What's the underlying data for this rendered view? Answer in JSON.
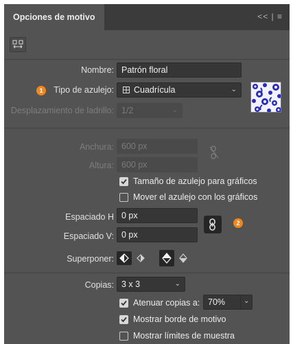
{
  "window": {
    "title": "Opciones de motivo",
    "controls": "<< | ≡"
  },
  "fields": {
    "nombre_label": "Nombre:",
    "nombre_value": "Patrón floral",
    "tipo_label": "Tipo de azulejo:",
    "tipo_value": "Cuadrícula",
    "desplazamiento_label": "Desplazamiento de ladrillo:",
    "desplazamiento_value": "1/2",
    "anchura_label": "Anchura:",
    "anchura_value": "600 px",
    "altura_label": "Altura:",
    "altura_value": "600 px",
    "espaciado_h_label": "Espaciado H",
    "espaciado_h_value": "0 px",
    "espaciado_v_label": "Espaciado V:",
    "espaciado_v_value": "0 px",
    "superponer_label": "Superponer:",
    "copias_label": "Copias:",
    "copias_value": "3 x 3",
    "atenuar_value": "70%"
  },
  "badges": {
    "one": "1",
    "two": "2"
  },
  "checkboxes": {
    "tamano": {
      "label": "Tamaño de azulejo para gráficos",
      "checked": true
    },
    "mover": {
      "label": "Mover el azulejo con los gráficos",
      "checked": false
    },
    "atenuar": {
      "label": "Atenuar copias a:",
      "checked": true
    },
    "borde": {
      "label": "Mostrar borde de motivo",
      "checked": true
    },
    "limites": {
      "label": "Mostrar límites de muestra",
      "checked": false
    }
  },
  "colors": {
    "panel": "#535353",
    "accent": "#f0861e",
    "pattern": "#2a2fb5"
  },
  "icons": [
    "fit-tile-icon",
    "grid-icon",
    "chevron-down-icon",
    "link-icon",
    "unlink-icon",
    "overlap-left-icon",
    "overlap-right-icon",
    "overlap-top-icon",
    "overlap-bottom-icon"
  ]
}
